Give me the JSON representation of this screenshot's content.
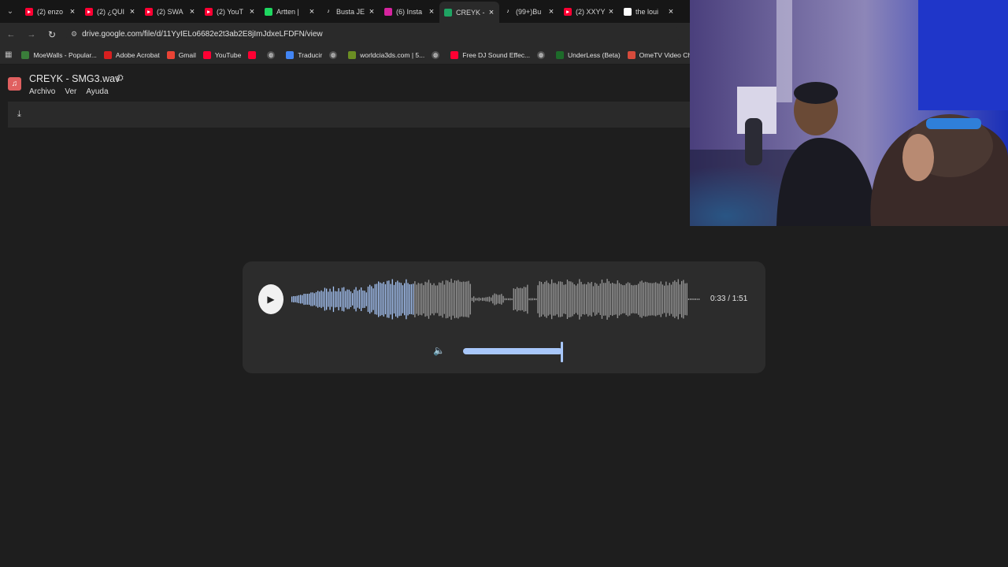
{
  "browser": {
    "tabs": [
      {
        "label": "(2) enzo",
        "icon": "youtube-icon",
        "color": "#ff0033",
        "active": false
      },
      {
        "label": "(2) ¿QUI",
        "icon": "youtube-icon",
        "color": "#ff0033",
        "active": false
      },
      {
        "label": "(2) SWA",
        "icon": "youtube-icon",
        "color": "#ff0033",
        "active": false
      },
      {
        "label": "(2) YouT",
        "icon": "youtube-icon",
        "color": "#ff0033",
        "active": false
      },
      {
        "label": "Artten |",
        "icon": "spotify-icon",
        "color": "#1ed760",
        "active": false
      },
      {
        "label": "Busta JE",
        "icon": "tiktok-icon",
        "color": "#161616",
        "active": false
      },
      {
        "label": "(6) Insta",
        "icon": "instagram-icon",
        "color": "#d6249f",
        "active": false
      },
      {
        "label": "CREYK -",
        "icon": "google-drive-icon",
        "color": "#1fa463",
        "active": true
      },
      {
        "label": "(99+)Bu",
        "icon": "tiktok-icon",
        "color": "#161616",
        "active": false
      },
      {
        "label": "(2) XXYY",
        "icon": "youtube-icon",
        "color": "#ff0033",
        "active": false
      },
      {
        "label": "the loui",
        "icon": "google-icon",
        "color": "#ffffff",
        "active": false
      }
    ],
    "url": "drive.google.com/file/d/11YyIELo6682e2t3ab2E8jImJdxeLFDFN/view",
    "bookmarks": [
      {
        "label": "MoeWalls - Popular...",
        "icon": "moewalls-icon",
        "color": "#3a7d3a"
      },
      {
        "label": "Adobe Acrobat",
        "icon": "acrobat-icon",
        "color": "#d71f1f"
      },
      {
        "label": "Gmail",
        "icon": "gmail-icon",
        "color": "#ea4335"
      },
      {
        "label": "YouTube",
        "icon": "youtube-icon",
        "color": "#ff0033"
      },
      {
        "label": "",
        "icon": "youtube-icon",
        "color": "#ff0033"
      },
      {
        "label": "",
        "icon": "globe-icon",
        "color": "#555555"
      },
      {
        "label": "Traducir",
        "icon": "translate-icon",
        "color": "#4285f4"
      },
      {
        "label": "",
        "icon": "globe-icon",
        "color": "#555555"
      },
      {
        "label": "worldcia3ds.com | 5...",
        "icon": "worldcia-icon",
        "color": "#6b8e23"
      },
      {
        "label": "",
        "icon": "globe-icon",
        "color": "#555555"
      },
      {
        "label": "Free DJ Sound Effec...",
        "icon": "youtube-icon",
        "color": "#ff0033"
      },
      {
        "label": "",
        "icon": "globe-icon",
        "color": "#555555"
      },
      {
        "label": "UnderLess (Beta)",
        "icon": "underless-icon",
        "color": "#1d6b2a"
      },
      {
        "label": "OmeTV Video Chat...",
        "icon": "ometv-icon",
        "color": "#d64b3c"
      }
    ]
  },
  "drive": {
    "file_name": "CREYK - SMG3.wav",
    "menu": [
      "Archivo",
      "Ver",
      "Ayuda"
    ]
  },
  "player": {
    "time": "0:33 / 1:51",
    "progress": 0.3,
    "volume": 1.0,
    "accent": "#a8c7fa",
    "unplayed": "#9a9a9a"
  }
}
